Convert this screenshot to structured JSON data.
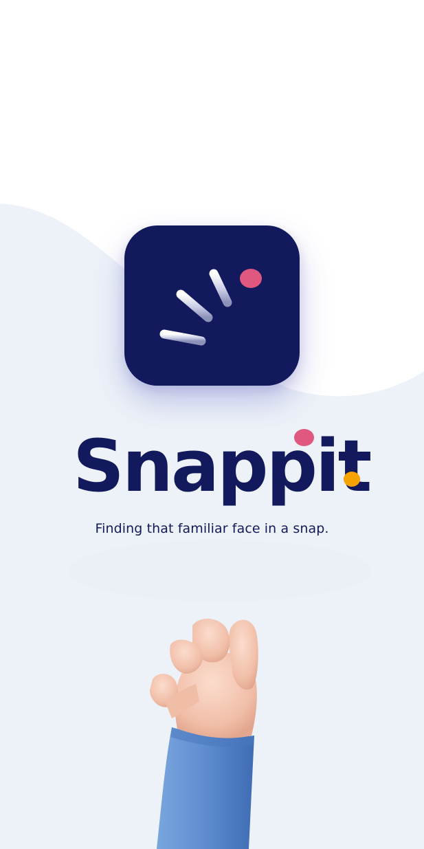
{
  "brand": {
    "name": "Snappit",
    "tagline": "Finding that familiar face in a snap.",
    "colors": {
      "navy": "#12195c",
      "pink_dot": "#e0577f",
      "orange_dot": "#f6a200",
      "background_wave": "#edf2f8",
      "sleeve_blue": "#5f8ed0",
      "skin": "#f3c6b4"
    }
  },
  "icons": {
    "app_icon": "snap-lines-logo-icon",
    "illustration": "snapping-hand-illustration"
  }
}
